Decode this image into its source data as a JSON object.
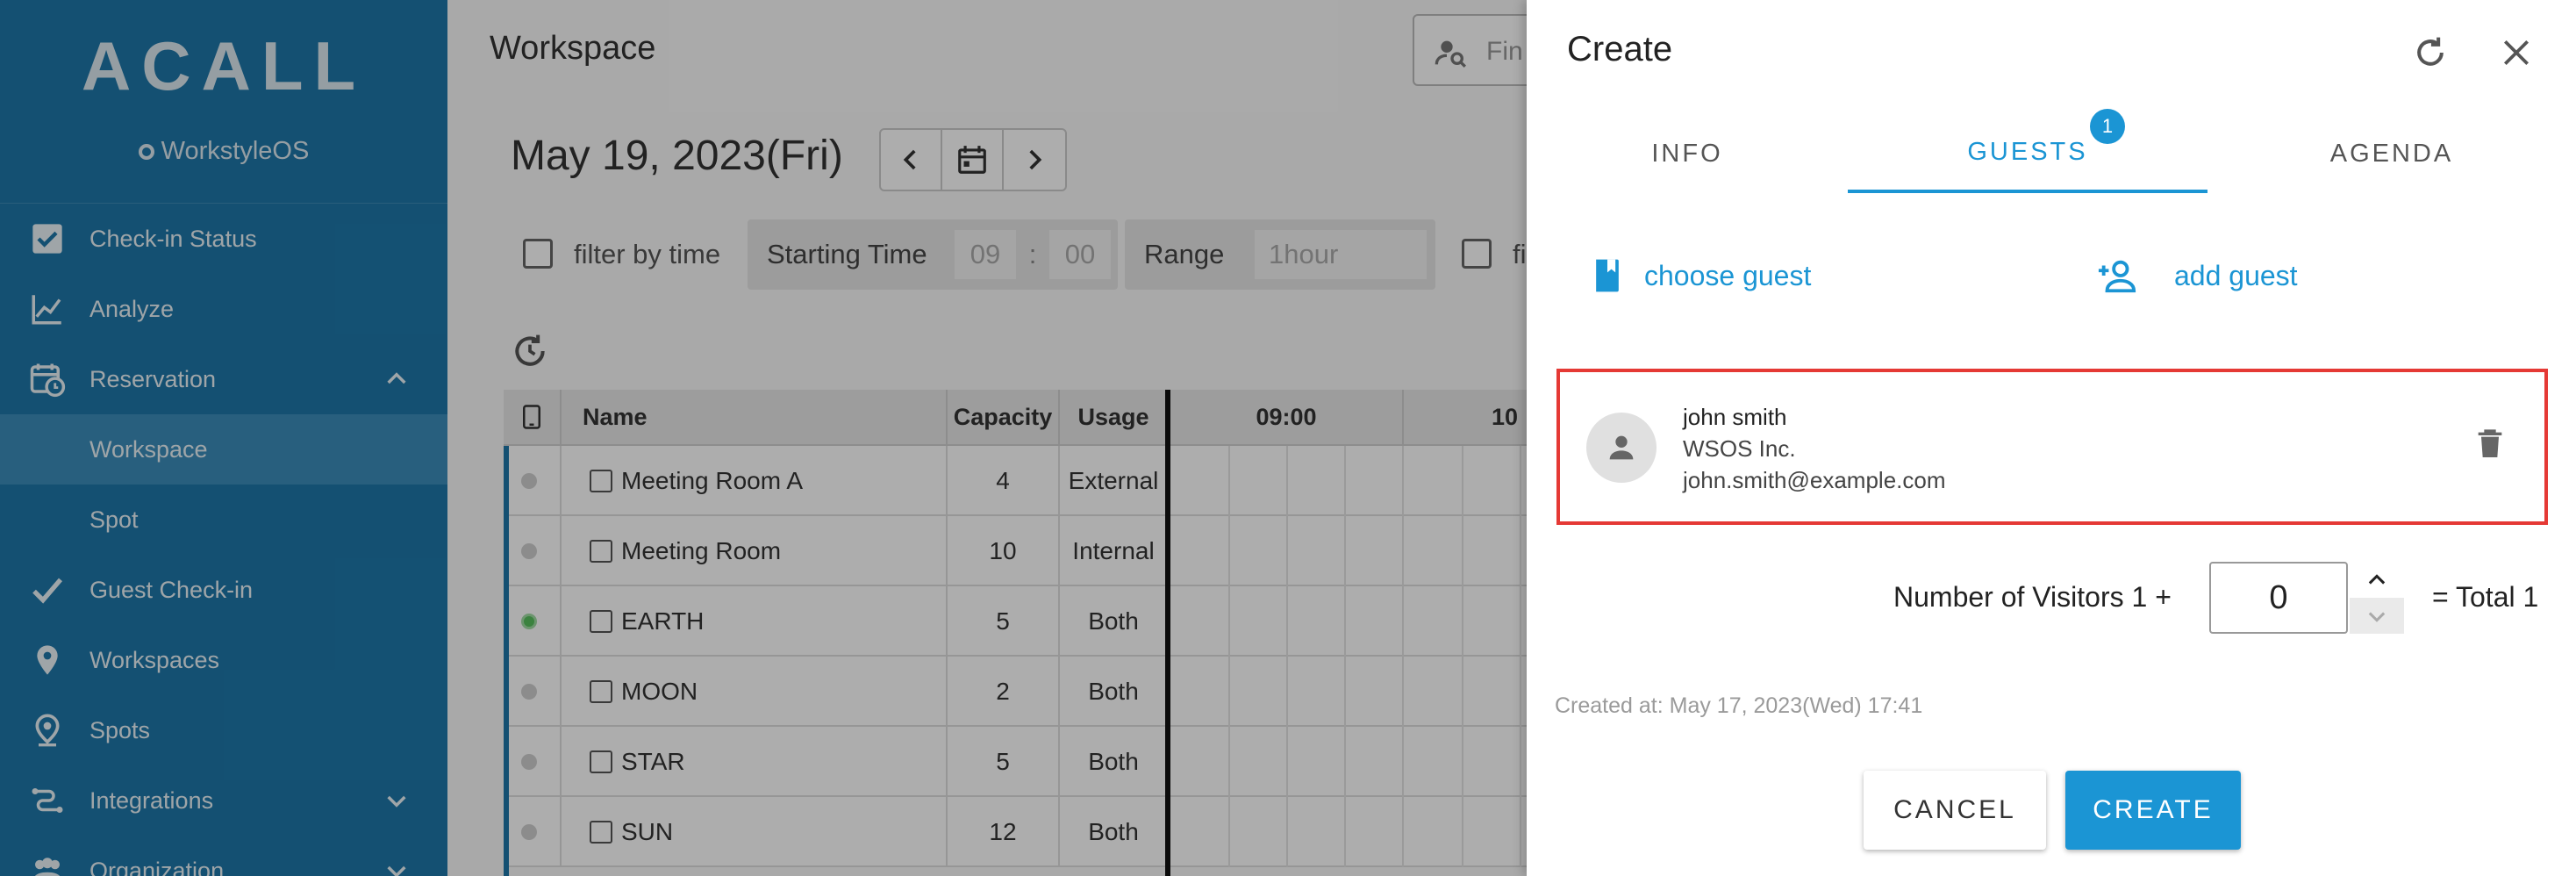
{
  "sidebar": {
    "logo": "ACALL",
    "sublogo": "WorkstyleOS",
    "items": [
      {
        "label": "Check-in Status",
        "icon": "check-box-icon"
      },
      {
        "label": "Analyze",
        "icon": "line-chart-icon"
      },
      {
        "label": "Reservation",
        "icon": "calendar-clock-icon",
        "expanded": true
      },
      {
        "label": "Workspace",
        "sub": true,
        "active": true
      },
      {
        "label": "Spot",
        "sub": true
      },
      {
        "label": "Guest Check-in",
        "icon": "checkmark-icon"
      },
      {
        "label": "Workspaces",
        "icon": "location-pin-icon"
      },
      {
        "label": "Spots",
        "icon": "person-pin-icon"
      },
      {
        "label": "Integrations",
        "icon": "integrations-icon",
        "expandable": true
      },
      {
        "label": "Organization",
        "icon": "people-icon",
        "expandable": true
      }
    ]
  },
  "main": {
    "title": "Workspace",
    "find_placeholder": "Fin",
    "date": "May 19, 2023(Fri)",
    "filter_by_time": "filter by time",
    "starting_time_label": "Starting Time",
    "start_hour": "09",
    "time_sep": ":",
    "start_min": "00",
    "range_label": "Range",
    "range_value": "1hour",
    "filter2_label": "fi",
    "columns": {
      "name": "Name",
      "capacity": "Capacity",
      "usage": "Usage",
      "time1": "09:00",
      "time2": "10"
    },
    "rows": [
      {
        "name": "Meeting Room A",
        "capacity": "4",
        "usage": "External",
        "status": "grey"
      },
      {
        "name": "Meeting Room",
        "capacity": "10",
        "usage": "Internal",
        "status": "grey"
      },
      {
        "name": "EARTH",
        "capacity": "5",
        "usage": "Both",
        "status": "green"
      },
      {
        "name": "MOON",
        "capacity": "2",
        "usage": "Both",
        "status": "grey"
      },
      {
        "name": "STAR",
        "capacity": "5",
        "usage": "Both",
        "status": "grey"
      },
      {
        "name": "SUN",
        "capacity": "12",
        "usage": "Both",
        "status": "grey"
      }
    ]
  },
  "drawer": {
    "title": "Create",
    "tabs": {
      "info": "INFO",
      "guests": "GUESTS",
      "agenda": "AGENDA",
      "guests_badge": "1"
    },
    "choose_guest": "choose guest",
    "add_guest": "add guest",
    "guest": {
      "name": "john smith",
      "company": "WSOS Inc.",
      "email": "john.smith@example.com"
    },
    "visitors_label": "Number of Visitors 1 +",
    "visitors_value": "0",
    "total": "= Total 1",
    "created_at": "Created at: May 17, 2023(Wed) 17:41",
    "cancel": "CANCEL",
    "create": "CREATE"
  },
  "colors": {
    "sidebar": "#1e77a9",
    "accent": "#1b95d4",
    "highlight_border": "#e53935",
    "available": "#58c05e"
  }
}
